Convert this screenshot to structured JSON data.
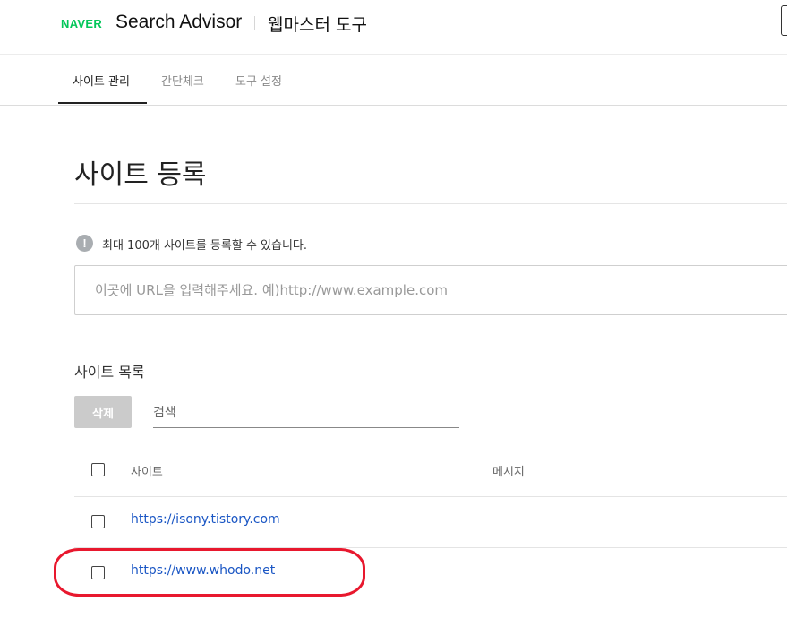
{
  "header": {
    "logo": "NAVER",
    "product": "Search Advisor",
    "tool": "웹마스터 도구"
  },
  "tabs": [
    {
      "label": "사이트 관리",
      "active": true
    },
    {
      "label": "간단체크",
      "active": false
    },
    {
      "label": "도구 설정",
      "active": false
    }
  ],
  "page": {
    "title": "사이트 등록",
    "info_icon": "info-icon",
    "info_text": "최대 100개 사이트를 등록할 수 있습니다.",
    "url_input": {
      "value": "",
      "placeholder": "이곳에 URL을 입력해주세요. 예)http://www.example.com"
    }
  },
  "site_list": {
    "title": "사이트 목록",
    "delete_label": "삭제",
    "search_placeholder": "검색",
    "columns": [
      "사이트",
      "메시지"
    ],
    "rows": [
      {
        "url": "https://isony.tistory.com",
        "message": ""
      },
      {
        "url": "https://www.whodo.net",
        "message": ""
      }
    ]
  },
  "colors": {
    "brand": "#03c75a",
    "link": "#1a56c4",
    "highlight": "#e8182e"
  }
}
